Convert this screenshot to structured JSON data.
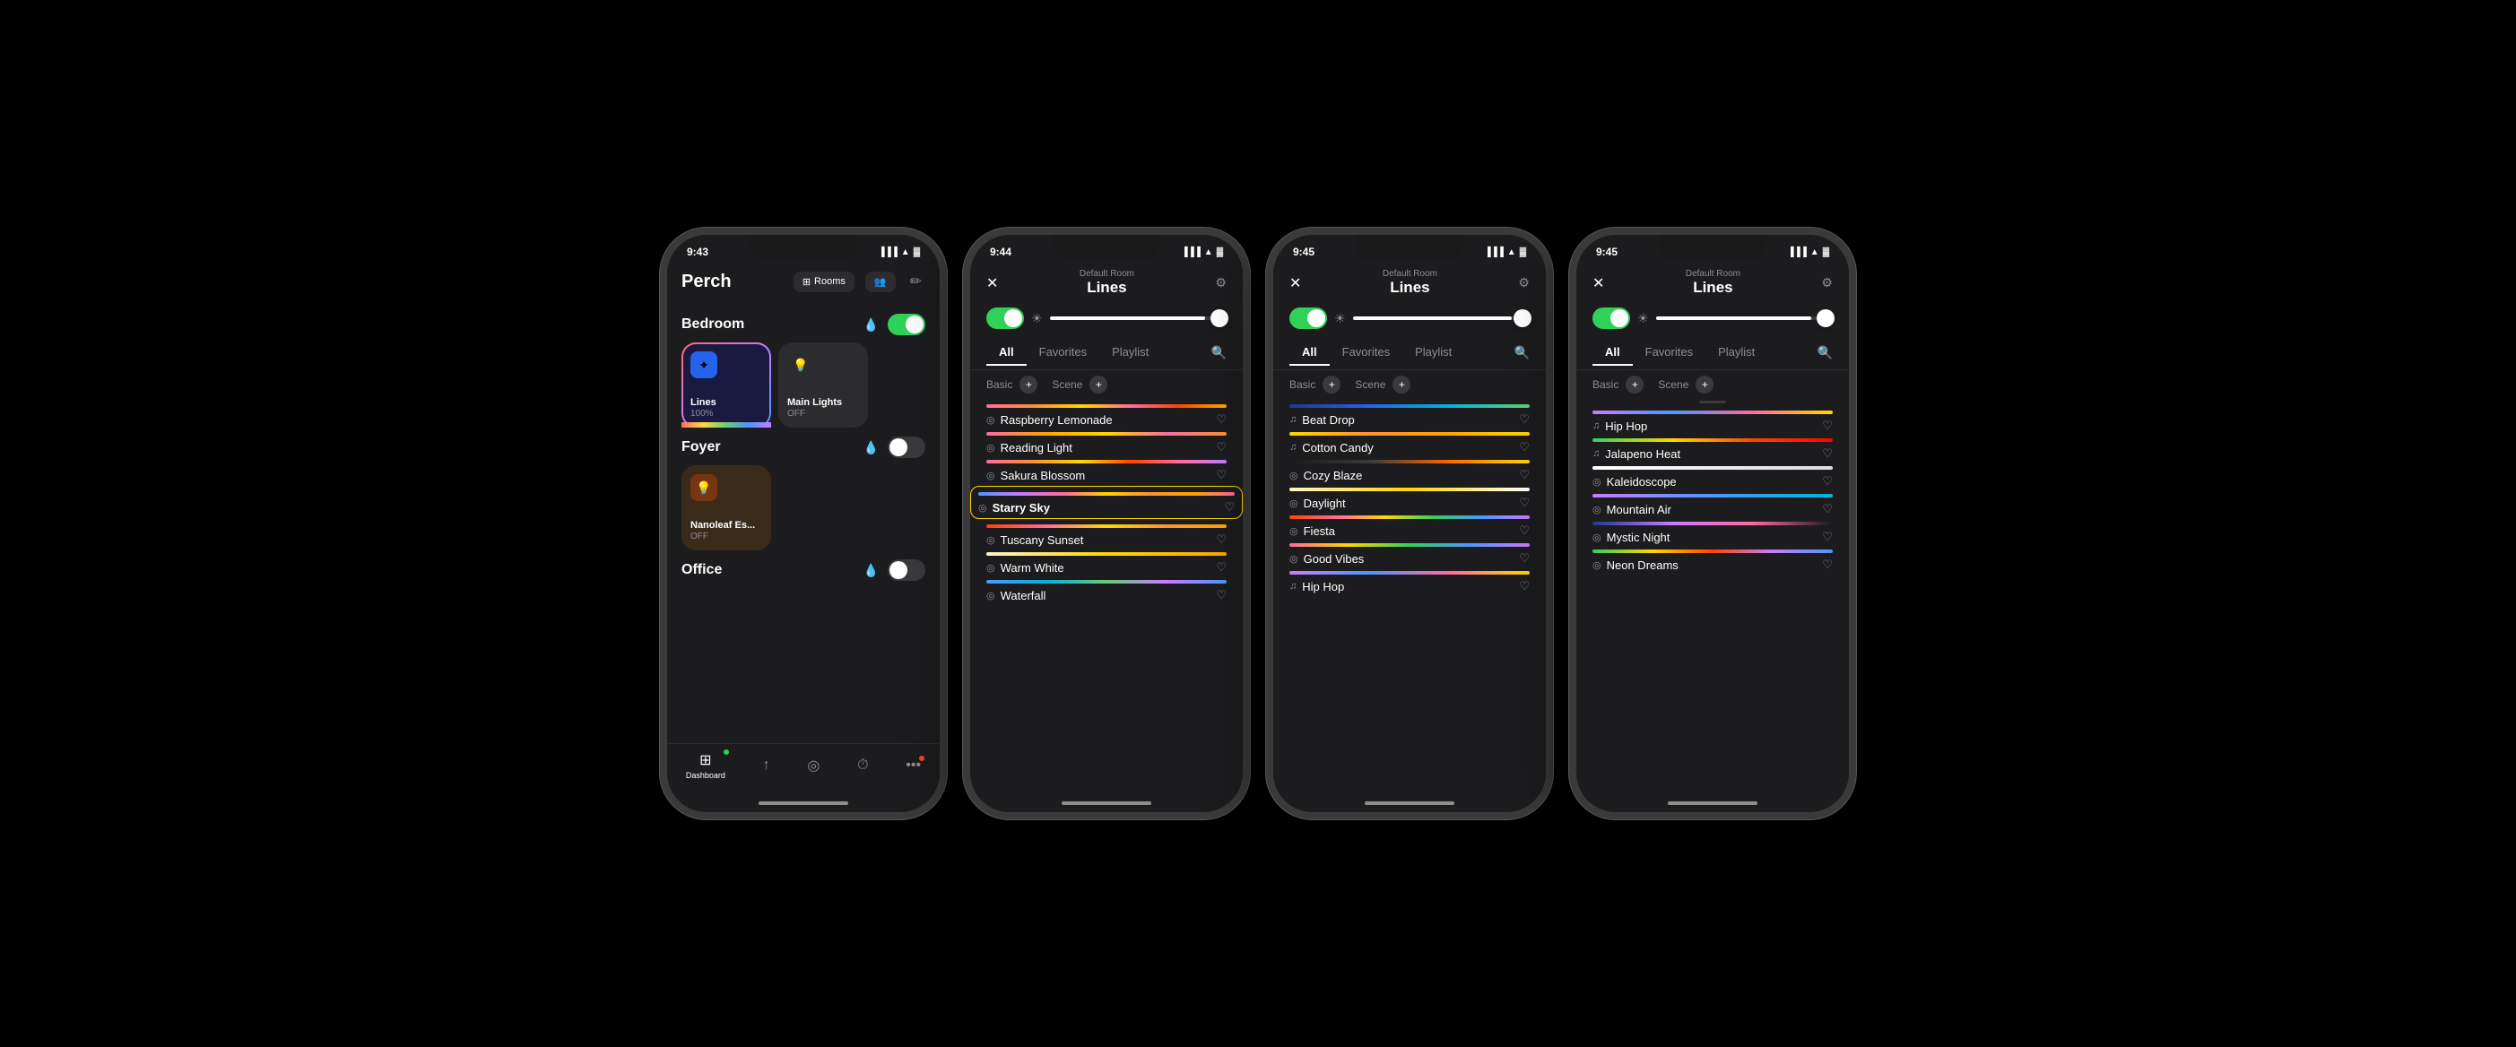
{
  "phones": [
    {
      "id": "home",
      "status_time": "9:43",
      "header_title": "Perch",
      "rooms_label": "Rooms",
      "sections": [
        {
          "name": "Bedroom",
          "toggle": "on",
          "devices": [
            {
              "name": "Lines",
              "status": "100%",
              "icon": "✦",
              "type": "lines",
              "active": true
            },
            {
              "name": "Main Lights",
              "status": "OFF",
              "icon": "💡",
              "type": "bulb",
              "active": false
            }
          ]
        },
        {
          "name": "Foyer",
          "toggle": "off",
          "devices": [
            {
              "name": "Nanoleaf Es...",
              "status": "OFF",
              "icon": "💡",
              "type": "nanoleaf",
              "active": false
            }
          ]
        },
        {
          "name": "Office",
          "toggle": "off",
          "devices": []
        }
      ],
      "tabs": [
        {
          "label": "Dashboard",
          "icon": "⊞",
          "active": true,
          "dot": "green"
        },
        {
          "label": "",
          "icon": "↑",
          "active": false
        },
        {
          "label": "",
          "icon": "◎",
          "active": false
        },
        {
          "label": "",
          "icon": "⏱",
          "active": false
        },
        {
          "label": "",
          "icon": "•••",
          "active": false,
          "dot": "red"
        }
      ]
    },
    {
      "id": "lines1",
      "status_time": "9:44",
      "room_label": "Default Room",
      "title": "Lines",
      "tabs": [
        "All",
        "Favorites",
        "Playlist"
      ],
      "active_tab": "All",
      "scenes": [
        {
          "name": "Raspberry Lemonade",
          "type": "basic",
          "icon": "◎",
          "color_class": "cb-raspberry",
          "favorited": false
        },
        {
          "name": "Reading Light",
          "type": "basic",
          "icon": "◎",
          "color_class": "cb-reading",
          "favorited": false
        },
        {
          "name": "Sakura Blossom",
          "type": "basic",
          "icon": "◎",
          "color_class": "cb-sakura",
          "favorited": false
        },
        {
          "name": "Starry Sky",
          "type": "basic",
          "icon": "◎",
          "color_class": "cb-starry",
          "favorited": false,
          "selected": true
        },
        {
          "name": "Tuscany Sunset",
          "type": "basic",
          "icon": "◎",
          "color_class": "cb-tuscany",
          "favorited": false
        },
        {
          "name": "Warm White",
          "type": "basic",
          "icon": "◎",
          "color_class": "cb-warm",
          "favorited": false
        },
        {
          "name": "Waterfall",
          "type": "basic",
          "icon": "◎",
          "color_class": "cb-waterfall",
          "favorited": false
        }
      ]
    },
    {
      "id": "lines2",
      "status_time": "9:45",
      "room_label": "Default Room",
      "title": "Lines",
      "tabs": [
        "All",
        "Favorites",
        "Playlist"
      ],
      "active_tab": "All",
      "scenes": [
        {
          "name": "Beat Drop",
          "type": "music",
          "icon": "♫",
          "color_class": "cb-beat",
          "favorited": false
        },
        {
          "name": "Cotton Candy",
          "type": "music",
          "icon": "♫",
          "color_class": "cb-cotton",
          "favorited": false
        },
        {
          "name": "Cozy Blaze",
          "type": "basic",
          "icon": "◎",
          "color_class": "cb-cozy",
          "favorited": false
        },
        {
          "name": "Daylight",
          "type": "basic",
          "icon": "◎",
          "color_class": "cb-daylight",
          "favorited": false
        },
        {
          "name": "Fiesta",
          "type": "basic",
          "icon": "◎",
          "color_class": "cb-fiesta",
          "favorited": false
        },
        {
          "name": "Good Vibes",
          "type": "basic",
          "icon": "◎",
          "color_class": "cb-good",
          "favorited": false
        },
        {
          "name": "Hip Hop",
          "type": "music",
          "icon": "♫",
          "color_class": "cb-hiphop",
          "favorited": false
        }
      ]
    },
    {
      "id": "lines3",
      "status_time": "9:45",
      "room_label": "Default Room",
      "title": "Lines",
      "tabs": [
        "All",
        "Favorites",
        "Playlist"
      ],
      "active_tab": "All",
      "scenes": [
        {
          "name": "Hip Hop",
          "type": "music",
          "icon": "♫",
          "color_class": "cb-hiphop",
          "favorited": false
        },
        {
          "name": "Jalapeno Heat",
          "type": "basic",
          "icon": "◎",
          "color_class": "cb-jalapeno",
          "favorited": false
        },
        {
          "name": "Kaleidoscope",
          "type": "basic",
          "icon": "◎",
          "color_class": "cb-kaleidoscope",
          "favorited": false
        },
        {
          "name": "Mountain Air",
          "type": "basic",
          "icon": "◎",
          "color_class": "cb-mountain",
          "favorited": false
        },
        {
          "name": "Mystic Night",
          "type": "basic",
          "icon": "◎",
          "color_class": "cb-mystic",
          "favorited": false
        },
        {
          "name": "Neon Dreams",
          "type": "basic",
          "icon": "◎",
          "color_class": "cb-neon",
          "favorited": false
        }
      ]
    }
  ]
}
